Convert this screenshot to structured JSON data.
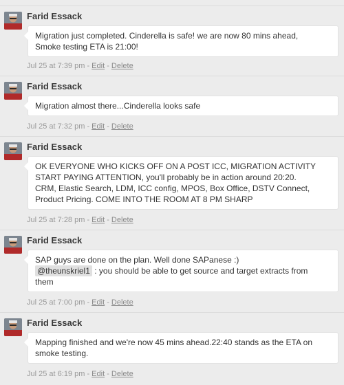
{
  "colors": {
    "background": "#ececec",
    "bubble": "#ffffff",
    "meta_text": "#9a9a9a"
  },
  "posts": [
    {
      "author": "Farid Essack",
      "avatar_icon": "user-avatar",
      "lines": [
        "Migration just completed. Cinderella is safe! we are now 80 mins ahead,",
        "Smoke testing ETA is 21:00!"
      ],
      "timestamp": "Jul 25 at 7:39 pm",
      "sep1": " - ",
      "edit_label": "Edit",
      "sep2": " - ",
      "delete_label": "Delete"
    },
    {
      "author": "Farid Essack",
      "avatar_icon": "user-avatar",
      "lines": [
        "Migration almost there...Cinderella looks safe"
      ],
      "timestamp": "Jul 25 at 7:32 pm",
      "sep1": " - ",
      "edit_label": "Edit",
      "sep2": " - ",
      "delete_label": "Delete"
    },
    {
      "author": "Farid Essack",
      "avatar_icon": "user-avatar",
      "lines": [
        "OK EVERYONE WHO KICKS OFF ON A POST ICC, MIGRATION ACTIVITY",
        "START PAYING ATTENTION, you'll probably be in action around 20:20.",
        "CRM, Elastic Search, LDM, ICC config, MPOS, Box Office, DSTV Connect,",
        "Product Pricing. COME INTO THE ROOM AT 8 PM SHARP"
      ],
      "timestamp": "Jul 25 at 7:28 pm",
      "sep1": " - ",
      "edit_label": "Edit",
      "sep2": " - ",
      "delete_label": "Delete"
    },
    {
      "author": "Farid Essack",
      "avatar_icon": "user-avatar",
      "line1": "SAP guys are done on the plan. Well done SAPanese :)",
      "mention": "@theunskriel1",
      "line2_rest": " : you should be able to get source and target extracts from",
      "line3": "them",
      "timestamp": "Jul 25 at 7:00 pm",
      "sep1": " - ",
      "edit_label": "Edit",
      "sep2": " - ",
      "delete_label": "Delete"
    },
    {
      "author": "Farid Essack",
      "avatar_icon": "user-avatar",
      "lines": [
        "Mapping finished and we're now 45 mins ahead.22:40 stands as the ETA on",
        "smoke testing."
      ],
      "timestamp": "Jul 25 at 6:19 pm",
      "sep1": " - ",
      "edit_label": "Edit",
      "sep2": " - ",
      "delete_label": "Delete"
    }
  ]
}
